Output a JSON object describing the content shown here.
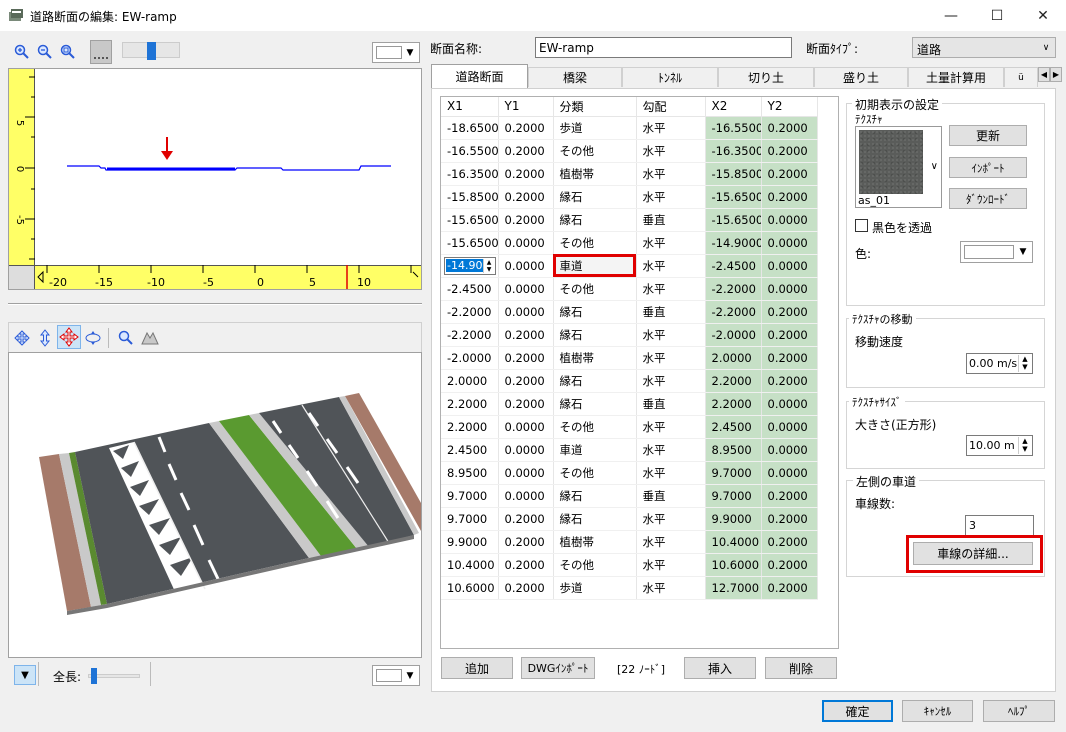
{
  "window": {
    "title": "道路断面の編集: EW-ramp",
    "minimize": "—",
    "maximize": "☐",
    "close": "✕"
  },
  "left_toolbar": {
    "icons": [
      "zoom-in-icon",
      "zoom-out-icon",
      "zoom-fit-icon",
      "grid-icon"
    ]
  },
  "ruler": {
    "vertical_labels": [
      "5",
      "0",
      "-5"
    ],
    "horizontal_labels": [
      "-20",
      "-15",
      "-10",
      "-5",
      "0",
      "5",
      "10"
    ]
  },
  "view3d_toolbar": {
    "icons": [
      "rotate-icon",
      "move-vertical-icon",
      "move-icon",
      "orbit-icon",
      "zoom-icon",
      "perspective-icon"
    ]
  },
  "bottom_left": {
    "length_label": "全長:"
  },
  "form": {
    "name_label": "断面名称:",
    "name_value": "EW-ramp",
    "type_label": "断面ﾀｲﾌﾟ:",
    "type_value": "道路"
  },
  "tabs": [
    {
      "label": "道路断面",
      "active": true
    },
    {
      "label": "橋梁",
      "active": false
    },
    {
      "label": "ﾄﾝﾈﾙ",
      "active": false
    },
    {
      "label": "切り土",
      "active": false
    },
    {
      "label": "盛り土",
      "active": false
    },
    {
      "label": "土量計算用",
      "active": false
    },
    {
      "label": "ü",
      "active": false
    }
  ],
  "table": {
    "headers": [
      "X1",
      "Y1",
      "分類",
      "勾配",
      "X2",
      "Y2"
    ],
    "rows": [
      [
        "-18.6500",
        "0.2000",
        "歩道",
        "水平",
        "-16.5500",
        "0.2000"
      ],
      [
        "-16.5500",
        "0.2000",
        "その他",
        "水平",
        "-16.3500",
        "0.2000"
      ],
      [
        "-16.3500",
        "0.2000",
        "植樹帯",
        "水平",
        "-15.8500",
        "0.2000"
      ],
      [
        "-15.8500",
        "0.2000",
        "縁石",
        "水平",
        "-15.6500",
        "0.2000"
      ],
      [
        "-15.6500",
        "0.2000",
        "縁石",
        "垂直",
        "-15.6500",
        "0.0000"
      ],
      [
        "-15.6500",
        "0.0000",
        "その他",
        "水平",
        "-14.9000",
        "0.0000"
      ],
      [
        "-14.90",
        "0.0000",
        "車道",
        "水平",
        "-2.4500",
        "0.0000"
      ],
      [
        "-2.4500",
        "0.0000",
        "その他",
        "水平",
        "-2.2000",
        "0.0000"
      ],
      [
        "-2.2000",
        "0.0000",
        "縁石",
        "垂直",
        "-2.2000",
        "0.2000"
      ],
      [
        "-2.2000",
        "0.2000",
        "縁石",
        "水平",
        "-2.0000",
        "0.2000"
      ],
      [
        "-2.0000",
        "0.2000",
        "植樹帯",
        "水平",
        "2.0000",
        "0.2000"
      ],
      [
        "2.0000",
        "0.2000",
        "縁石",
        "水平",
        "2.2000",
        "0.2000"
      ],
      [
        "2.2000",
        "0.2000",
        "縁石",
        "垂直",
        "2.2000",
        "0.0000"
      ],
      [
        "2.2000",
        "0.0000",
        "その他",
        "水平",
        "2.4500",
        "0.0000"
      ],
      [
        "2.4500",
        "0.0000",
        "車道",
        "水平",
        "8.9500",
        "0.0000"
      ],
      [
        "8.9500",
        "0.0000",
        "その他",
        "水平",
        "9.7000",
        "0.0000"
      ],
      [
        "9.7000",
        "0.0000",
        "縁石",
        "垂直",
        "9.7000",
        "0.2000"
      ],
      [
        "9.7000",
        "0.2000",
        "縁石",
        "水平",
        "9.9000",
        "0.2000"
      ],
      [
        "9.9000",
        "0.2000",
        "植樹帯",
        "水平",
        "10.4000",
        "0.2000"
      ],
      [
        "10.4000",
        "0.2000",
        "その他",
        "水平",
        "10.6000",
        "0.2000"
      ],
      [
        "10.6000",
        "0.2000",
        "歩道",
        "水平",
        "12.7000",
        "0.2000"
      ]
    ]
  },
  "table_buttons": {
    "add": "追加",
    "dwg_import": "DWGｲﾝﾎﾟｰﾄ",
    "node_count": "[22 ﾉｰﾄﾞ]",
    "insert": "挿入",
    "delete": "削除"
  },
  "initial_display": {
    "title": "初期表示の設定",
    "texture_label": "ﾃｸｽﾁｬ",
    "texture_name": "as_01",
    "update": "更新",
    "import": "ｲﾝﾎﾟｰﾄ",
    "download": "ﾀﾞｳﾝﾛｰﾄﾞ",
    "transparent_label": "黒色を透過",
    "color_label": "色:"
  },
  "texture_move": {
    "title": "ﾃｸｽﾁｬの移動",
    "speed_label": "移動速度",
    "speed_value": "0.00 m/s"
  },
  "texture_size": {
    "title": "ﾃｸｽﾁｬｻｲｽﾞ",
    "size_label": "大きさ(正方形)",
    "size_value": "10.00 m"
  },
  "left_lanes": {
    "title": "左側の車道",
    "lane_count_label": "車線数:",
    "lane_count_value": "3",
    "detail_button": "車線の詳細..."
  },
  "dialog_buttons": {
    "ok": "確定",
    "cancel": "ｷｬﾝｾﾙ",
    "help": "ﾍﾙﾌﾟ"
  },
  "colors": {
    "highlight_red": "#e00000",
    "x2_column": "#c6e0c6",
    "ruler_yellow": "#ffff66",
    "profile_blue": "#0000ff"
  }
}
